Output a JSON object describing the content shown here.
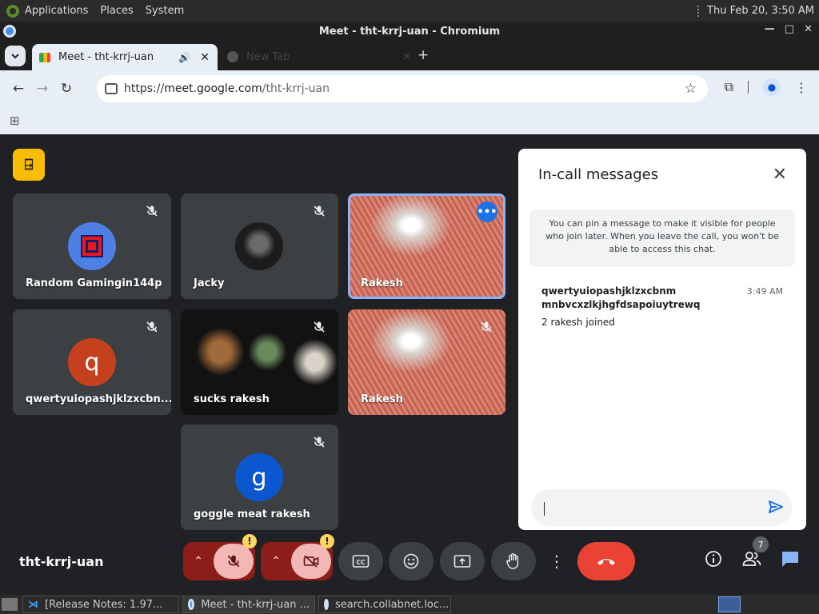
{
  "topbar": {
    "menus": [
      "Applications",
      "Places",
      "System"
    ],
    "clock": "Thu Feb 20,  3:50 AM"
  },
  "window": {
    "title": "Meet - tht-krrj-uan - Chromium",
    "controls": [
      "—",
      "□",
      "✕"
    ]
  },
  "tabs": {
    "active": {
      "label": "Meet - tht-krrj-uan"
    },
    "inactive": {
      "label": "New Tab"
    },
    "new_tab": "+"
  },
  "omnibox": {
    "scheme": "https://",
    "host": "meet.google.com",
    "path": "/tht-krrj-uan"
  },
  "tiles": [
    {
      "name": "Random Gamingin144p",
      "type": "avatar"
    },
    {
      "name": "Jacky",
      "type": "photo"
    },
    {
      "name": "Rakesh",
      "type": "video"
    },
    {
      "name": "qwertyuiopashjklzxcbn...",
      "type": "avatar",
      "initial": "q"
    },
    {
      "name": "sucks rakesh",
      "type": "video"
    },
    {
      "name": "Rakesh",
      "type": "video"
    },
    {
      "name": "goggle meat rakesh",
      "type": "avatar",
      "initial": "g"
    }
  ],
  "chat": {
    "title": "In-call messages",
    "info": "You can pin a message to make it visible for people who join later. When you leave the call, you won't be able to access this chat.",
    "sender": "qwertyuiopashjklzxcbnm mnbvcxzlkjhgfdsapoiuytrewq",
    "time": "3:49 AM",
    "message": "2 rakesh joined",
    "input_value": ""
  },
  "controls": {
    "meeting_code": "tht-krrj-uan",
    "warning_mark": "!",
    "participants_count": "7"
  },
  "taskbar": {
    "items": [
      "[Release Notes: 1.97...",
      "Meet - tht-krrj-uan ...",
      "search.collabnet.loc..."
    ]
  },
  "colors": {
    "end_call": "#ea4335",
    "mic_off_bg": "#f2b8b5",
    "accent": "#8ab4f8",
    "warning": "#fdd663"
  }
}
